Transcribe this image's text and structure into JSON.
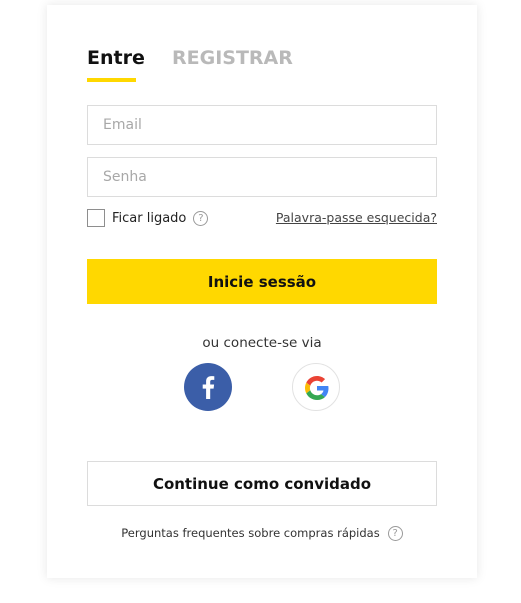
{
  "tabs": {
    "login_label": "Entre",
    "register_label": "REGISTRAR"
  },
  "form": {
    "email_placeholder": "Email",
    "password_placeholder": "Senha",
    "remember_label": "Ficar ligado",
    "forgot_label": "Palavra-passe esquecida?",
    "submit_label": "Inicie sessão"
  },
  "social": {
    "label": "ou conecte-se via",
    "providers": [
      {
        "name": "facebook",
        "icon": "facebook-icon",
        "color": "#3b5ea8"
      },
      {
        "name": "google",
        "icon": "google-icon"
      }
    ]
  },
  "guest": {
    "label": "Continue como convidado"
  },
  "faq": {
    "label": "Perguntas frequentes sobre compras rápidas"
  },
  "colors": {
    "accent": "#ffd800",
    "inactive_tab": "#b9b9b9"
  }
}
